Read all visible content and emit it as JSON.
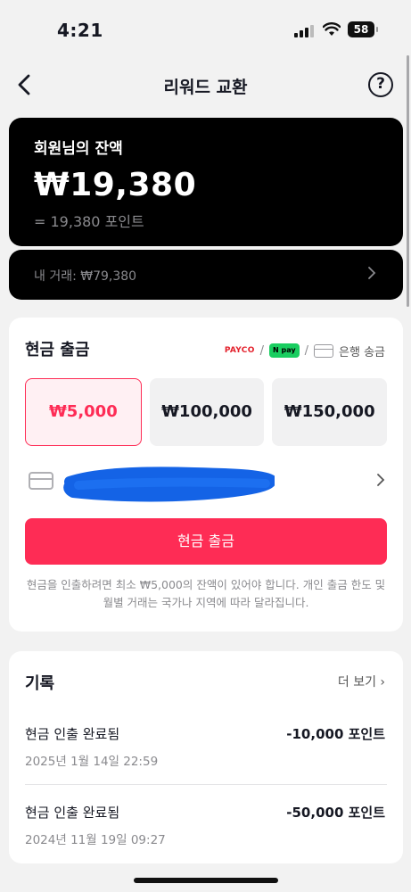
{
  "status_bar": {
    "time": "4:21",
    "battery": "58"
  },
  "header": {
    "title": "리워드 교환",
    "help": "?"
  },
  "balance": {
    "label": "회원님의 잔액",
    "amount": "₩19,380",
    "points": "= 19,380 포인트",
    "transactions": "내 거래: ₩79,380"
  },
  "withdraw": {
    "title": "현금 출금",
    "methods": {
      "payco": "PAYCO",
      "sep1": "/",
      "npay": "N pay",
      "sep2": "/",
      "bank": "은행 송금"
    },
    "options": [
      {
        "label": "₩5,000",
        "selected": true
      },
      {
        "label": "₩100,000",
        "selected": false
      },
      {
        "label": "₩150,000",
        "selected": false
      }
    ],
    "button": "현금 출금",
    "notice": "현금을 인출하려면 최소 ₩5,000의 잔액이 있어야 합니다. 개인 출금 한도 및 월별 거래는 국가나 지역에 따라 달라집니다."
  },
  "history": {
    "title": "기록",
    "more": "더 보기 ›",
    "items": [
      {
        "title": "현금 인출 완료됨",
        "date": "2025년 1월 14일 22:59",
        "amount": "-10,000 포인트"
      },
      {
        "title": "현금 인출 완료됨",
        "date": "2024년 11월 19일 09:27",
        "amount": "-50,000 포인트"
      }
    ]
  },
  "colors": {
    "accent": "#fe2c55",
    "card": "#000000",
    "background": "#f2f2f2",
    "muted": "#8a8a8e"
  }
}
